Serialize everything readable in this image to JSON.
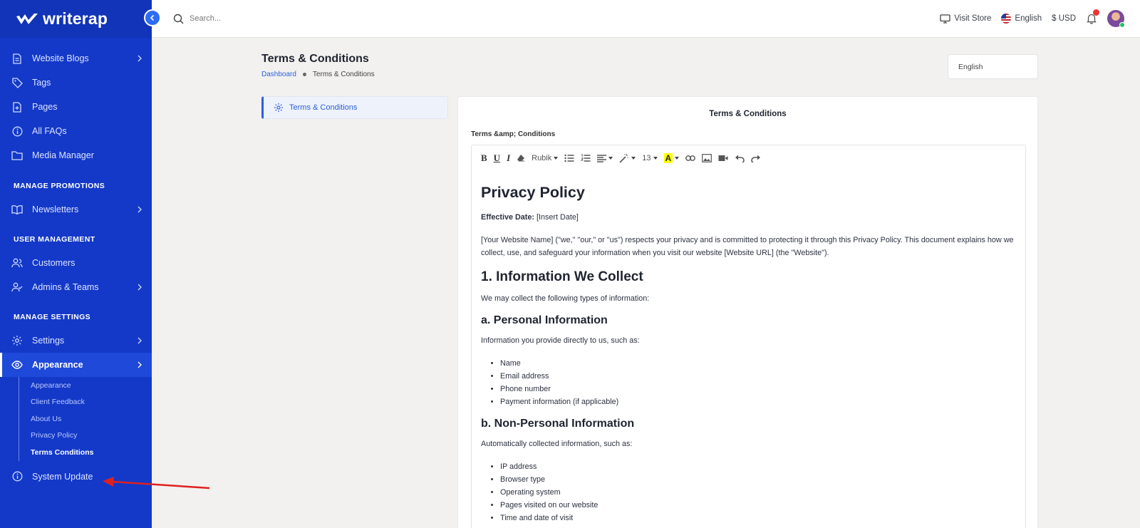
{
  "brand": {
    "name": "writerap"
  },
  "sidebar": {
    "items_top": [
      {
        "label": "Website Blogs",
        "icon": "document-icon",
        "chevron": true
      },
      {
        "label": "Tags",
        "icon": "tag-icon",
        "chevron": false
      },
      {
        "label": "Pages",
        "icon": "page-add-icon",
        "chevron": false
      },
      {
        "label": "All FAQs",
        "icon": "info-circle-icon",
        "chevron": false
      },
      {
        "label": "Media Manager",
        "icon": "folder-icon",
        "chevron": false
      }
    ],
    "section_promotions": "MANAGE PROMOTIONS",
    "item_newsletters": "Newsletters",
    "section_users": "USER MANAGEMENT",
    "item_customers": "Customers",
    "item_admins": "Admins & Teams",
    "section_settings": "MANAGE SETTINGS",
    "item_settings": "Settings",
    "item_appearance": "Appearance",
    "sub_items": [
      "Appearance",
      "Client Feedback",
      "About Us",
      "Privacy Policy",
      "Terms Conditions"
    ],
    "item_system_update": "System Update"
  },
  "topbar": {
    "search_placeholder": "Search...",
    "visit_store": "Visit Store",
    "language": "English",
    "currency": "$ USD"
  },
  "page": {
    "title": "Terms & Conditions",
    "breadcrumb_home": "Dashboard",
    "breadcrumb_current": "Terms & Conditions",
    "language_select": "English",
    "side_tab": "Terms & Conditions"
  },
  "card": {
    "title": "Terms & Conditions",
    "field_label": "Terms &amp; Conditions"
  },
  "toolbar": {
    "font_name": "Rubik",
    "font_size": "13",
    "highlight_letter": "A"
  },
  "doc": {
    "h1": "Privacy Policy",
    "effective_label": "Effective Date:",
    "effective_value": " [Insert Date]",
    "intro": "[Your Website Name] (\"we,\" \"our,\" or \"us\") respects your privacy and is committed to protecting it through this Privacy Policy. This document explains how we collect, use, and safeguard your information when you visit our website [Website URL] (the \"Website\").",
    "h2_collect": "1. Information We Collect",
    "collect_intro": "We may collect the following types of information:",
    "h3_personal": "a. Personal Information",
    "personal_intro": "Information you provide directly to us, such as:",
    "personal_list": [
      "Name",
      "Email address",
      "Phone number",
      "Payment information (if applicable)"
    ],
    "h3_nonpersonal": "b. Non-Personal Information",
    "nonpersonal_intro": "Automatically collected information, such as:",
    "nonpersonal_list": [
      "IP address",
      "Browser type",
      "Operating system",
      "Pages visited on our website",
      "Time and date of visit"
    ]
  },
  "colors": {
    "sidebar_bg": "#1439c8",
    "accent": "#2a5fe0",
    "annotation_arrow": "#e02020"
  }
}
